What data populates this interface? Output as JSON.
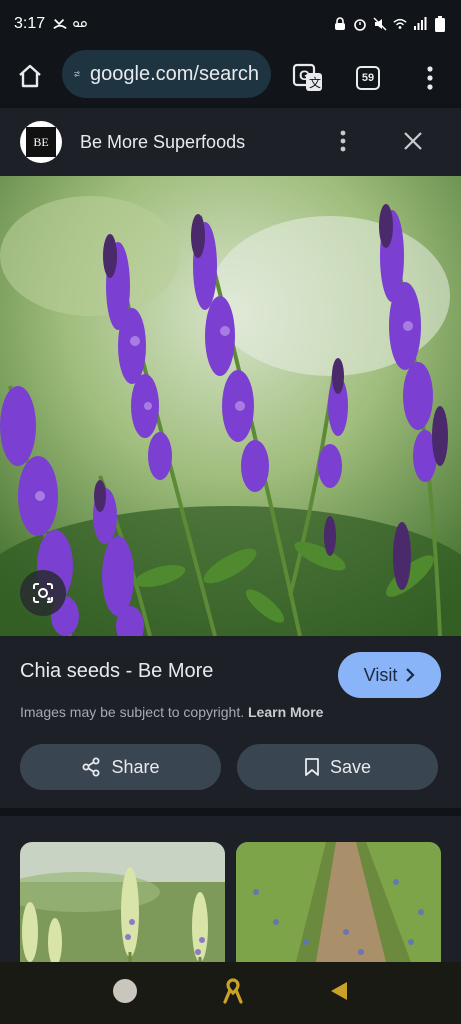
{
  "status": {
    "time": "3:17"
  },
  "toolbar": {
    "url": "google.com/search",
    "tab_count": "59"
  },
  "result": {
    "site_name": "Be More Superfoods",
    "logo_text": "BE",
    "title": "Chia seeds - Be More",
    "visit_label": "Visit",
    "copyright_text": "Images may be subject to copyright.",
    "learn_more": "Learn More",
    "share_label": "Share",
    "save_label": "Save"
  },
  "colors": {
    "accent": "#8ab4f8",
    "flower": "#7b3fd1"
  }
}
